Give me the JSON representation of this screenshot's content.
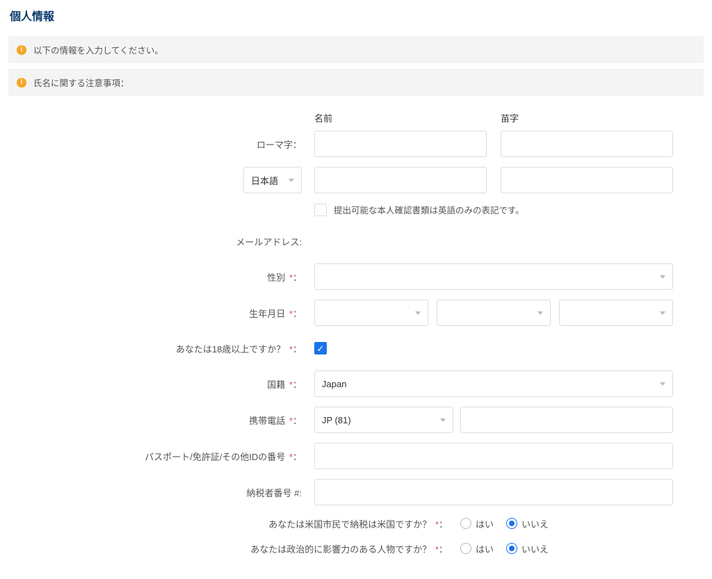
{
  "page": {
    "title": "個人情報"
  },
  "notices": {
    "info1": "以下の情報を入力してください。",
    "info2": "氏名に関する注意事項："
  },
  "headers": {
    "first_name": "名前",
    "last_name": "苗字"
  },
  "labels": {
    "romaji": "ローマ字：",
    "lang_select": "日本語",
    "english_only_docs": "提出可能な本人確認書類は英語のみの表記です。",
    "email": "メールアドレス:",
    "gender": "性別",
    "dob": "生年月日",
    "over18": "あなたは18歳以上ですか？",
    "nationality": "国籍",
    "phone": "携帯電話",
    "id_number": "パスポート/免許証/その他IDの番号",
    "tax_number": "納税者番号 #:",
    "us_citizen_q": "あなたは米国市民で納税は米国ですか？",
    "pep_q": "あなたは政治的に影響力のある人物ですか？",
    "yes": "はい",
    "no": "いいえ",
    "colon": "：",
    "colon_star": "* ："
  },
  "values": {
    "nationality": "Japan",
    "phone_country": "JP (81)",
    "over18_checked": true,
    "us_citizen": "no",
    "pep": "no"
  }
}
